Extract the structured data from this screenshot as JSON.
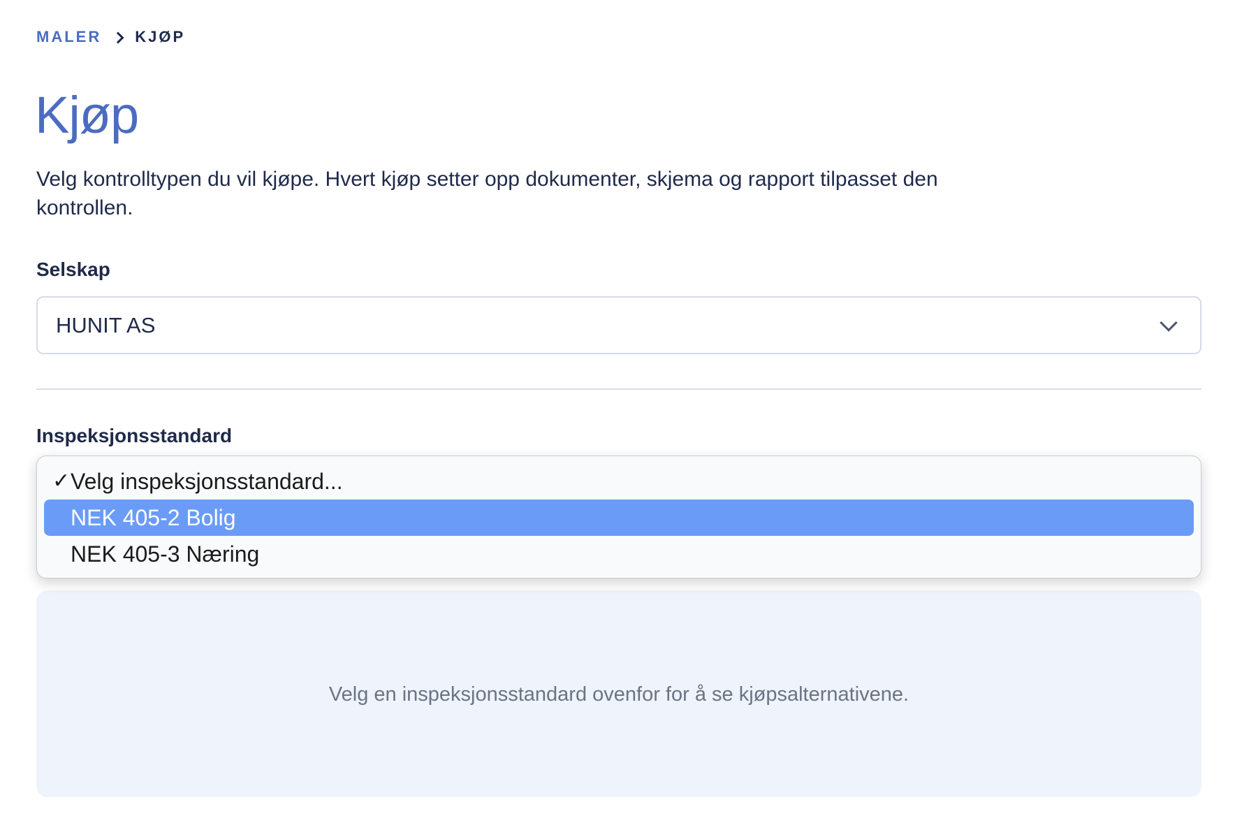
{
  "breadcrumb": {
    "parent": "MALER",
    "current": "KJØP"
  },
  "page": {
    "title": "Kjøp",
    "intro": "Velg kontrolltypen du vil kjøpe. Hvert kjøp setter opp dokumenter, skjema og rapport tilpasset den kontrollen."
  },
  "company": {
    "label": "Selskap",
    "value": "HUNIT AS"
  },
  "standard": {
    "label": "Inspeksjonsstandard",
    "options": [
      {
        "label": "Velg inspeksjonsstandard...",
        "checked": true
      },
      {
        "label": "NEK 405-2 Bolig",
        "highlighted": true
      },
      {
        "label": "NEK 405-3 Næring"
      }
    ],
    "check_glyph": "✓"
  },
  "empty_state": {
    "text": "Velg en inspeksjonsstandard ovenfor for å se kjøpsalternativene."
  },
  "colors": {
    "accent": "#4b6cc1",
    "highlight": "#6a9cf7",
    "panel": "#eff3fb"
  }
}
